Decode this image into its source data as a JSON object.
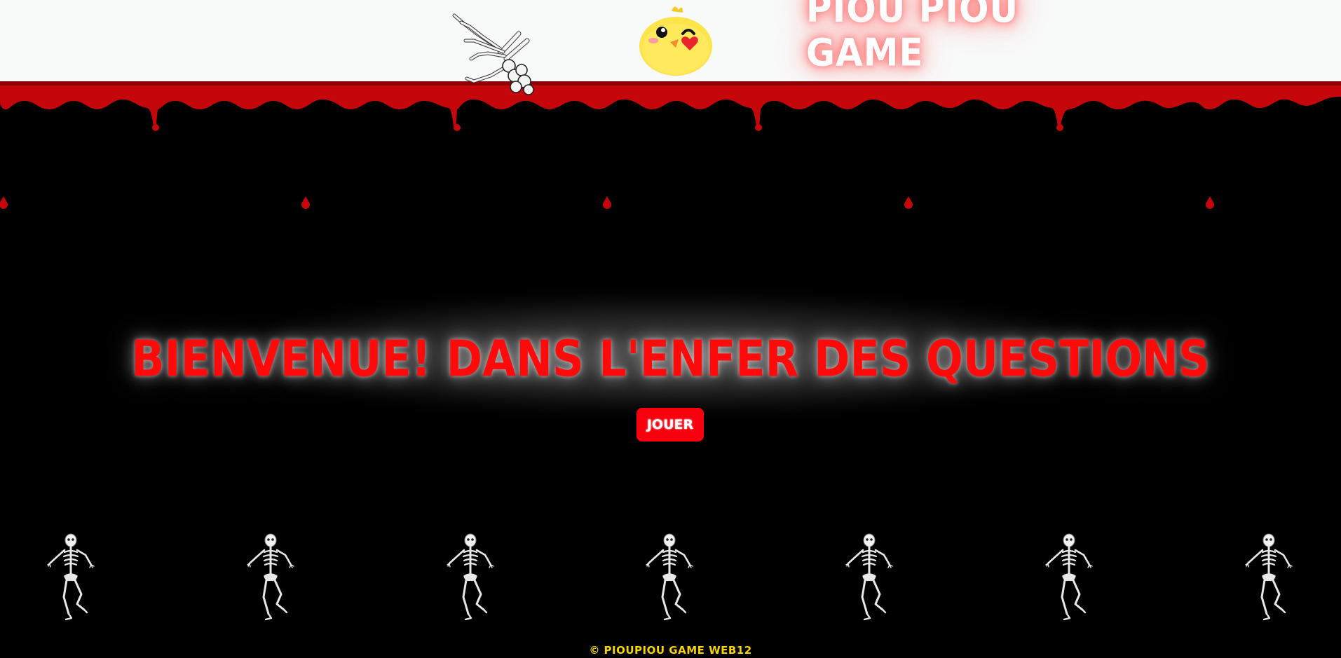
{
  "header": {
    "site_title": "PIOU PIOU GAME"
  },
  "main": {
    "welcome_title": "BIENVENUE! DANS L'ENFER DES QUESTIONS",
    "play_label": "JOUER"
  },
  "footer": {
    "copyright": "© PIOUPIOU GAME WEB12"
  },
  "icons": {
    "chick": "winking-chick-icon",
    "hand": "skeleton-hand-icon",
    "skeleton": "dancing-skeleton-icon",
    "blood": "blood-drip"
  },
  "colors": {
    "background": "#000000",
    "header_bg": "#f8f9f9",
    "blood": "#d20a0a",
    "title_red": "#ff0a0a",
    "button_red": "#f8000e",
    "footer_yellow": "#f5d400",
    "chick_yellow": "#fde44a"
  }
}
